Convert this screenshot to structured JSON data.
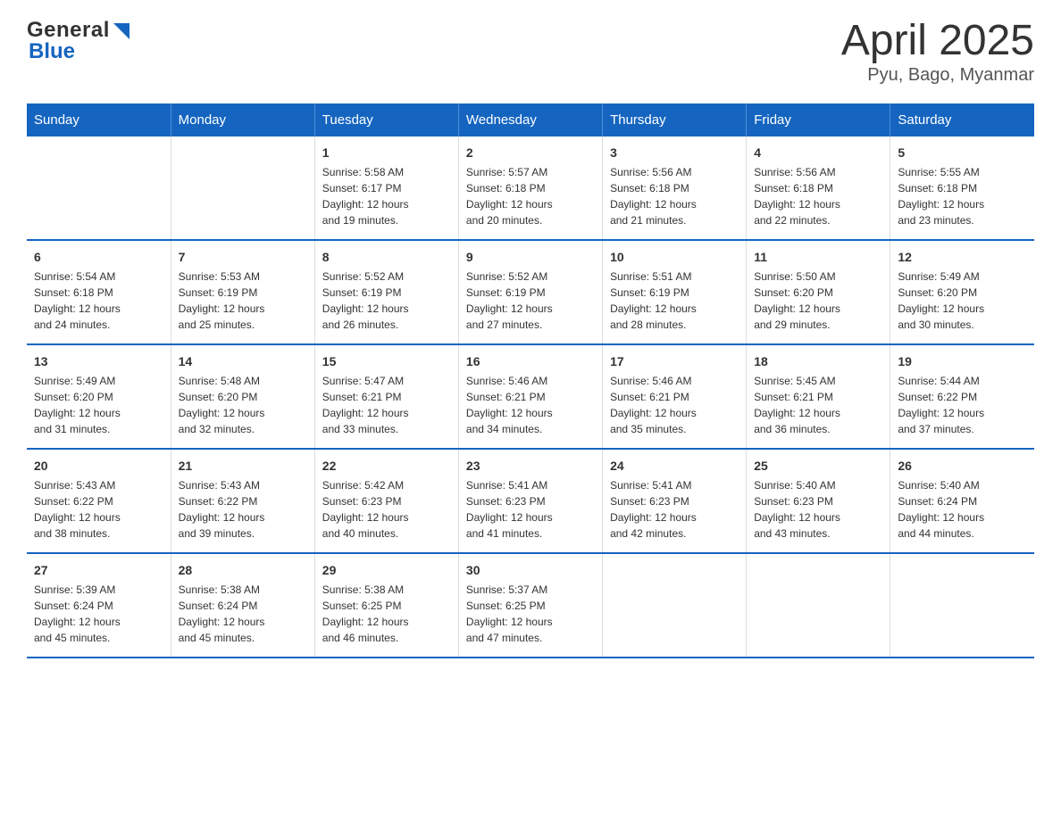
{
  "header": {
    "logo_general": "General",
    "logo_blue": "Blue",
    "title": "April 2025",
    "subtitle": "Pyu, Bago, Myanmar"
  },
  "days_of_week": [
    "Sunday",
    "Monday",
    "Tuesday",
    "Wednesday",
    "Thursday",
    "Friday",
    "Saturday"
  ],
  "weeks": [
    {
      "days": [
        {
          "num": "",
          "info": ""
        },
        {
          "num": "",
          "info": ""
        },
        {
          "num": "1",
          "info": "Sunrise: 5:58 AM\nSunset: 6:17 PM\nDaylight: 12 hours\nand 19 minutes."
        },
        {
          "num": "2",
          "info": "Sunrise: 5:57 AM\nSunset: 6:18 PM\nDaylight: 12 hours\nand 20 minutes."
        },
        {
          "num": "3",
          "info": "Sunrise: 5:56 AM\nSunset: 6:18 PM\nDaylight: 12 hours\nand 21 minutes."
        },
        {
          "num": "4",
          "info": "Sunrise: 5:56 AM\nSunset: 6:18 PM\nDaylight: 12 hours\nand 22 minutes."
        },
        {
          "num": "5",
          "info": "Sunrise: 5:55 AM\nSunset: 6:18 PM\nDaylight: 12 hours\nand 23 minutes."
        }
      ]
    },
    {
      "days": [
        {
          "num": "6",
          "info": "Sunrise: 5:54 AM\nSunset: 6:18 PM\nDaylight: 12 hours\nand 24 minutes."
        },
        {
          "num": "7",
          "info": "Sunrise: 5:53 AM\nSunset: 6:19 PM\nDaylight: 12 hours\nand 25 minutes."
        },
        {
          "num": "8",
          "info": "Sunrise: 5:52 AM\nSunset: 6:19 PM\nDaylight: 12 hours\nand 26 minutes."
        },
        {
          "num": "9",
          "info": "Sunrise: 5:52 AM\nSunset: 6:19 PM\nDaylight: 12 hours\nand 27 minutes."
        },
        {
          "num": "10",
          "info": "Sunrise: 5:51 AM\nSunset: 6:19 PM\nDaylight: 12 hours\nand 28 minutes."
        },
        {
          "num": "11",
          "info": "Sunrise: 5:50 AM\nSunset: 6:20 PM\nDaylight: 12 hours\nand 29 minutes."
        },
        {
          "num": "12",
          "info": "Sunrise: 5:49 AM\nSunset: 6:20 PM\nDaylight: 12 hours\nand 30 minutes."
        }
      ]
    },
    {
      "days": [
        {
          "num": "13",
          "info": "Sunrise: 5:49 AM\nSunset: 6:20 PM\nDaylight: 12 hours\nand 31 minutes."
        },
        {
          "num": "14",
          "info": "Sunrise: 5:48 AM\nSunset: 6:20 PM\nDaylight: 12 hours\nand 32 minutes."
        },
        {
          "num": "15",
          "info": "Sunrise: 5:47 AM\nSunset: 6:21 PM\nDaylight: 12 hours\nand 33 minutes."
        },
        {
          "num": "16",
          "info": "Sunrise: 5:46 AM\nSunset: 6:21 PM\nDaylight: 12 hours\nand 34 minutes."
        },
        {
          "num": "17",
          "info": "Sunrise: 5:46 AM\nSunset: 6:21 PM\nDaylight: 12 hours\nand 35 minutes."
        },
        {
          "num": "18",
          "info": "Sunrise: 5:45 AM\nSunset: 6:21 PM\nDaylight: 12 hours\nand 36 minutes."
        },
        {
          "num": "19",
          "info": "Sunrise: 5:44 AM\nSunset: 6:22 PM\nDaylight: 12 hours\nand 37 minutes."
        }
      ]
    },
    {
      "days": [
        {
          "num": "20",
          "info": "Sunrise: 5:43 AM\nSunset: 6:22 PM\nDaylight: 12 hours\nand 38 minutes."
        },
        {
          "num": "21",
          "info": "Sunrise: 5:43 AM\nSunset: 6:22 PM\nDaylight: 12 hours\nand 39 minutes."
        },
        {
          "num": "22",
          "info": "Sunrise: 5:42 AM\nSunset: 6:23 PM\nDaylight: 12 hours\nand 40 minutes."
        },
        {
          "num": "23",
          "info": "Sunrise: 5:41 AM\nSunset: 6:23 PM\nDaylight: 12 hours\nand 41 minutes."
        },
        {
          "num": "24",
          "info": "Sunrise: 5:41 AM\nSunset: 6:23 PM\nDaylight: 12 hours\nand 42 minutes."
        },
        {
          "num": "25",
          "info": "Sunrise: 5:40 AM\nSunset: 6:23 PM\nDaylight: 12 hours\nand 43 minutes."
        },
        {
          "num": "26",
          "info": "Sunrise: 5:40 AM\nSunset: 6:24 PM\nDaylight: 12 hours\nand 44 minutes."
        }
      ]
    },
    {
      "days": [
        {
          "num": "27",
          "info": "Sunrise: 5:39 AM\nSunset: 6:24 PM\nDaylight: 12 hours\nand 45 minutes."
        },
        {
          "num": "28",
          "info": "Sunrise: 5:38 AM\nSunset: 6:24 PM\nDaylight: 12 hours\nand 45 minutes."
        },
        {
          "num": "29",
          "info": "Sunrise: 5:38 AM\nSunset: 6:25 PM\nDaylight: 12 hours\nand 46 minutes."
        },
        {
          "num": "30",
          "info": "Sunrise: 5:37 AM\nSunset: 6:25 PM\nDaylight: 12 hours\nand 47 minutes."
        },
        {
          "num": "",
          "info": ""
        },
        {
          "num": "",
          "info": ""
        },
        {
          "num": "",
          "info": ""
        }
      ]
    }
  ]
}
